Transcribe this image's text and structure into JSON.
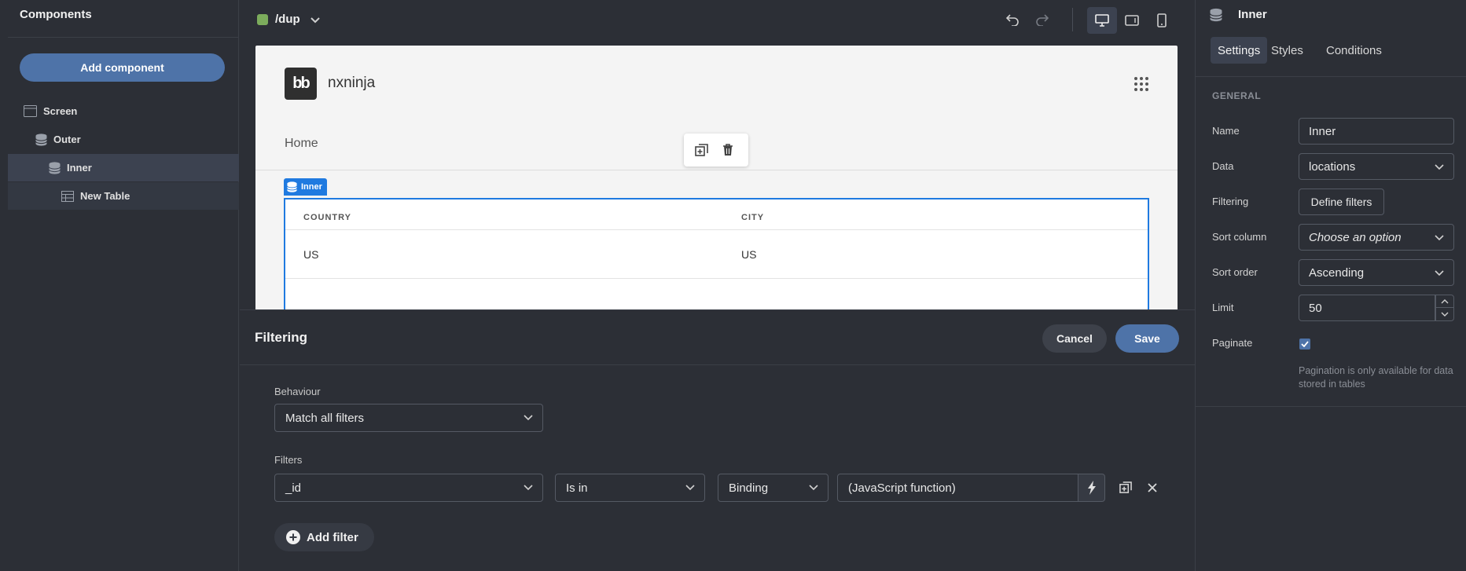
{
  "left_panel": {
    "title": "Components",
    "add_button": "Add component",
    "tree": [
      {
        "label": "Screen",
        "icon": "screen-icon"
      },
      {
        "label": "Outer",
        "icon": "database-icon"
      },
      {
        "label": "Inner",
        "icon": "database-icon"
      },
      {
        "label": "New Table",
        "icon": "table-icon"
      }
    ]
  },
  "top_bar": {
    "route": "/dup",
    "route_color": "#7cac5c"
  },
  "canvas": {
    "brand": "nxninja",
    "logo_text": "bb",
    "nav_item": "Home",
    "component_tag": "Inner",
    "table": {
      "columns": [
        "COUNTRY",
        "CITY"
      ],
      "rows": [
        [
          "US",
          "US"
        ]
      ]
    }
  },
  "filter_drawer": {
    "title": "Filtering",
    "cancel": "Cancel",
    "save": "Save",
    "behaviour_label": "Behaviour",
    "behaviour_value": "Match all filters",
    "filters_label": "Filters",
    "filter": {
      "field": "_id",
      "operator": "Is in",
      "type": "Binding",
      "value": "(JavaScript function)"
    },
    "add_filter": "Add filter"
  },
  "settings_panel": {
    "title": "Inner",
    "tabs": [
      "Settings",
      "Styles",
      "Conditions"
    ],
    "section": "GENERAL",
    "name_label": "Name",
    "name_value": "Inner",
    "data_label": "Data",
    "data_value": "locations",
    "filtering_label": "Filtering",
    "filtering_button": "Define filters",
    "sort_column_label": "Sort column",
    "sort_column_value": "Choose an option",
    "sort_order_label": "Sort order",
    "sort_order_value": "Ascending",
    "limit_label": "Limit",
    "limit_value": "50",
    "paginate_label": "Paginate",
    "paginate_checked": true,
    "paginate_note": "Pagination is only available for data stored in tables"
  },
  "colors": {
    "accent": "#4e73a8",
    "selection": "#1f7ae0"
  }
}
